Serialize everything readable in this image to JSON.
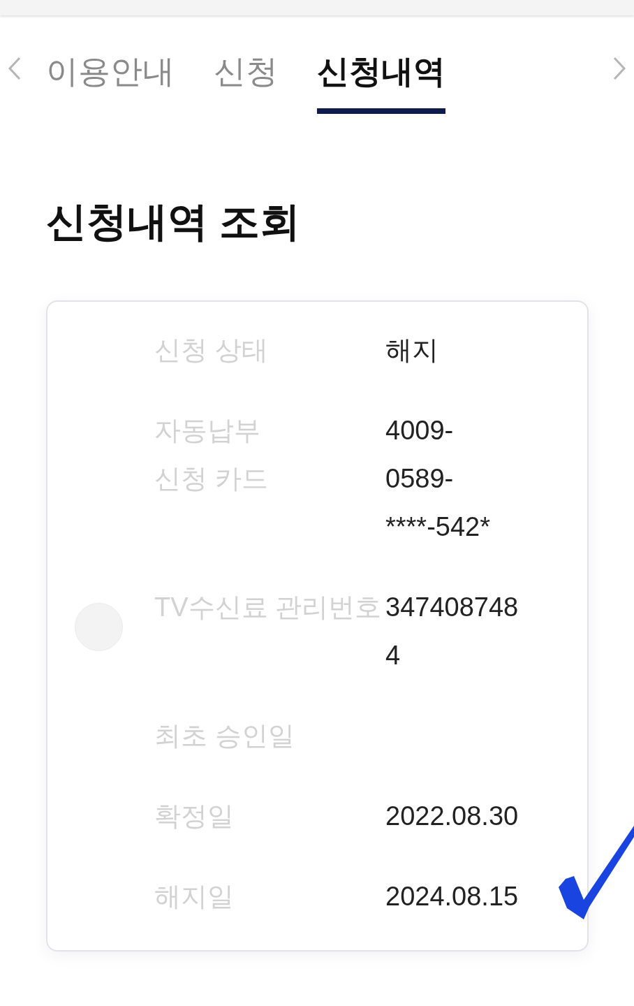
{
  "tabs": [
    {
      "label": "이용안내",
      "selected": false
    },
    {
      "label": "신청",
      "selected": false
    },
    {
      "label": "신청내역",
      "selected": true
    }
  ],
  "heading": "신청내역 조회",
  "details": [
    {
      "label_lines": [
        "신청 상태"
      ],
      "value_lines": [
        "해지"
      ]
    },
    {
      "label_lines": [
        "자동납부",
        "신청 카드"
      ],
      "value_lines": [
        "4009-",
        "0589-",
        "****-542*"
      ]
    },
    {
      "label_lines": [
        "TV수신료 관리번호"
      ],
      "value_lines": [
        "347408748",
        "4"
      ]
    },
    {
      "label_lines": [
        "최초 승인일"
      ]
    },
    {
      "label_lines": [
        "확정일"
      ],
      "value_lines": [
        "2022.08.30"
      ]
    },
    {
      "label_lines": [
        "해지일"
      ],
      "value_lines": [
        "2024.08.15"
      ]
    }
  ]
}
